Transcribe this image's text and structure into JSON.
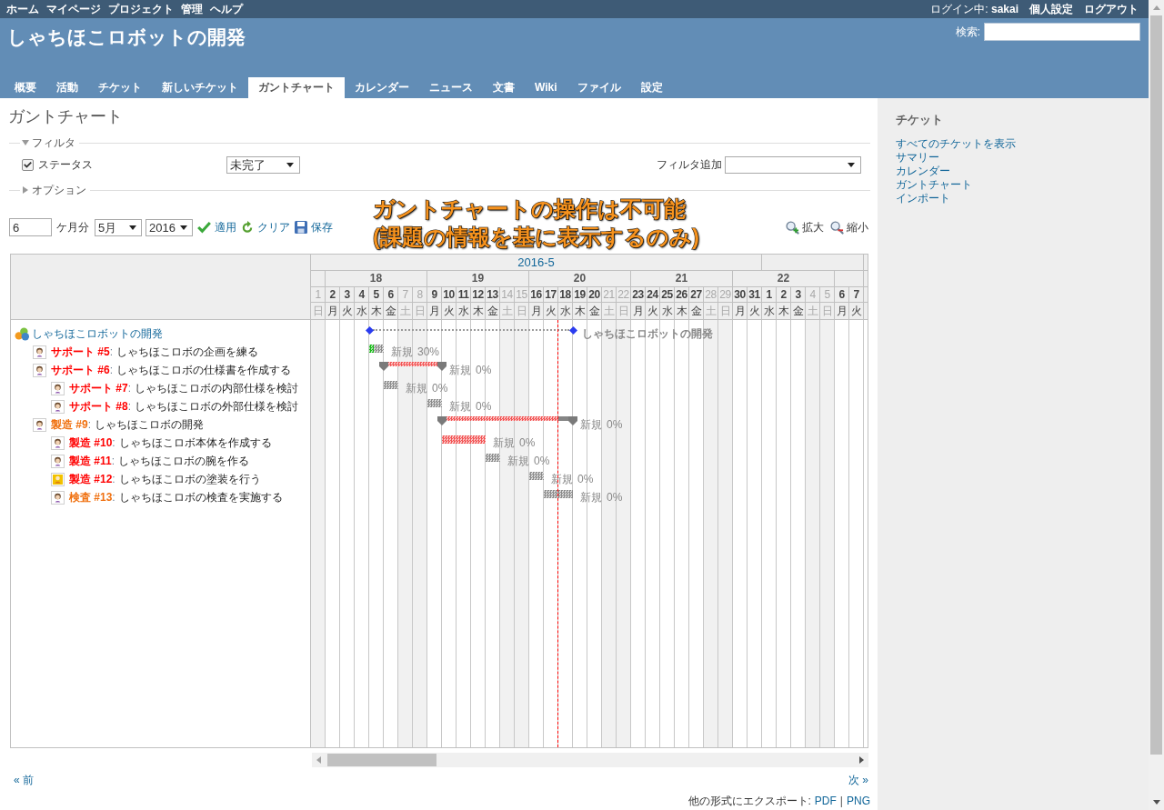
{
  "top_menu": {
    "items": [
      "ホーム",
      "マイページ",
      "プロジェクト",
      "管理",
      "ヘルプ"
    ],
    "login_label": "ログイン中:",
    "user": "sakai",
    "account_links": [
      "個人設定",
      "ログアウト"
    ]
  },
  "header": {
    "title": "しゃちほこロボットの開発",
    "search_label": "検索:"
  },
  "tabs": [
    {
      "label": "概要",
      "selected": false
    },
    {
      "label": "活動",
      "selected": false
    },
    {
      "label": "チケット",
      "selected": false
    },
    {
      "label": "新しいチケット",
      "selected": false
    },
    {
      "label": "ガントチャート",
      "selected": true
    },
    {
      "label": "カレンダー",
      "selected": false
    },
    {
      "label": "ニュース",
      "selected": false
    },
    {
      "label": "文書",
      "selected": false
    },
    {
      "label": "Wiki",
      "selected": false
    },
    {
      "label": "ファイル",
      "selected": false
    },
    {
      "label": "設定",
      "selected": false
    }
  ],
  "page_title": "ガントチャート",
  "filters": {
    "legend": "フィルタ",
    "expanded": true,
    "rows": [
      {
        "label": "ステータス",
        "checked": true,
        "value": "未完了"
      }
    ],
    "add_label": "フィルタ追加"
  },
  "options": {
    "legend": "オプション",
    "expanded": false
  },
  "controls": {
    "months": "6",
    "months_unit": "ケ月分",
    "month": "5月",
    "year": "2016",
    "actions": [
      {
        "kind": "apply",
        "label": "適用"
      },
      {
        "kind": "clear",
        "label": "クリア"
      },
      {
        "kind": "save",
        "label": "保存"
      }
    ],
    "zoom": [
      {
        "kind": "in",
        "label": "拡大"
      },
      {
        "kind": "out",
        "label": "縮小"
      }
    ]
  },
  "annotation": [
    "ガントチャートの操作は不可能",
    "(課題の情報を基に表示するのみ)"
  ],
  "gantt": {
    "months": [
      {
        "label": "2016-5",
        "weeks": [
          {
            "continued": false,
            "days": [
              {
                "label": "1",
                "weekday": "日",
                "weekend": true
              }
            ]
          },
          {
            "label": "18",
            "continued": false,
            "days": [
              {
                "label": "2",
                "weekday": "月",
                "weekend": false
              },
              {
                "label": "3",
                "weekday": "火",
                "weekend": false
              },
              {
                "label": "4",
                "weekday": "水",
                "weekend": false
              },
              {
                "label": "5",
                "weekday": "木",
                "weekend": false
              },
              {
                "label": "6",
                "weekday": "金",
                "weekend": false
              },
              {
                "label": "7",
                "weekday": "土",
                "weekend": true
              },
              {
                "label": "8",
                "weekday": "日",
                "weekend": true
              }
            ]
          },
          {
            "label": "19",
            "continued": false,
            "days": [
              {
                "label": "9",
                "weekday": "月",
                "weekend": false
              },
              {
                "label": "10",
                "weekday": "火",
                "weekend": false
              },
              {
                "label": "11",
                "weekday": "水",
                "weekend": false
              },
              {
                "label": "12",
                "weekday": "木",
                "weekend": false
              },
              {
                "label": "13",
                "weekday": "金",
                "weekend": false
              },
              {
                "label": "14",
                "weekday": "土",
                "weekend": true
              },
              {
                "label": "15",
                "weekday": "日",
                "weekend": true
              }
            ]
          },
          {
            "label": "20",
            "continued": false,
            "days": [
              {
                "label": "16",
                "weekday": "月",
                "weekend": false
              },
              {
                "label": "17",
                "weekday": "火",
                "weekend": false
              },
              {
                "label": "18",
                "weekday": "水",
                "weekend": false
              },
              {
                "label": "19",
                "weekday": "木",
                "weekend": false
              },
              {
                "label": "20",
                "weekday": "金",
                "weekend": false
              },
              {
                "label": "21",
                "weekday": "土",
                "weekend": true
              },
              {
                "label": "22",
                "weekday": "日",
                "weekend": true
              }
            ]
          },
          {
            "label": "21",
            "continued": false,
            "days": [
              {
                "label": "23",
                "weekday": "月",
                "weekend": false
              },
              {
                "label": "24",
                "weekday": "火",
                "weekend": false
              },
              {
                "label": "25",
                "weekday": "水",
                "weekend": false
              },
              {
                "label": "26",
                "weekday": "木",
                "weekend": false
              },
              {
                "label": "27",
                "weekday": "金",
                "weekend": false
              },
              {
                "label": "28",
                "weekday": "土",
                "weekend": true
              },
              {
                "label": "29",
                "weekday": "日",
                "weekend": true
              }
            ]
          },
          {
            "label": "22",
            "continued": false,
            "days": [
              {
                "label": "30",
                "weekday": "月",
                "weekend": false
              },
              {
                "label": "31",
                "weekday": "火",
                "weekend": false
              }
            ]
          }
        ]
      },
      {
        "weeks": [
          {
            "continued": true,
            "days": [
              {
                "label": "1",
                "weekday": "水",
                "weekend": false
              },
              {
                "label": "2",
                "weekday": "木",
                "weekend": false
              },
              {
                "label": "3",
                "weekday": "金",
                "weekend": false
              },
              {
                "label": "4",
                "weekday": "土",
                "weekend": true
              },
              {
                "label": "5",
                "weekday": "日",
                "weekend": true
              }
            ]
          },
          {
            "continued": false,
            "days": [
              {
                "label": "6",
                "weekday": "月",
                "weekend": false
              },
              {
                "label": "7",
                "weekday": "火",
                "weekend": false
              }
            ]
          }
        ]
      }
    ],
    "project": {
      "name": "しゃちほこロボットの開発",
      "bar_label": "しゃちほこロボットの開発",
      "children": [
        {
          "link": "サポート #5",
          "separator": ":",
          "subject": "しゃちほこロボの企画を練る",
          "color": "#ff0000",
          "avatar": {
            "kind": "person"
          },
          "kind": "task",
          "level": 0.3,
          "late": false,
          "status": "新規",
          "progress": "30%"
        },
        {
          "link": "サポート #6",
          "separator": ":",
          "subject": "しゃちほこロボの仕様書を作成する",
          "color": "#ff0000",
          "avatar": {
            "kind": "person"
          },
          "kind": "parent",
          "late": true,
          "status": "新規",
          "progress": "0%",
          "children": [
            {
              "link": "サポート #7",
              "separator": ":",
              "subject": "しゃちほこロボの内部仕様を検討",
              "color": "#ff0000",
              "avatar": {
                "kind": "person"
              },
              "kind": "task",
              "late": false,
              "status": "新規",
              "progress": "0%"
            },
            {
              "link": "サポート #8",
              "separator": ":",
              "subject": "しゃちほこロボの外部仕様を検討",
              "color": "#ff0000",
              "avatar": {
                "kind": "person"
              },
              "kind": "task",
              "late": false,
              "status": "新規",
              "progress": "0%"
            }
          ]
        },
        {
          "link": "製造 #9",
          "separator": ":",
          "subject": "しゃちほこロボの開発",
          "color": "#f0700f",
          "avatar": {
            "kind": "person"
          },
          "kind": "parent",
          "late": true,
          "status": "新規",
          "progress": "0%",
          "children": [
            {
              "link": "製造 #10",
              "separator": ":",
              "subject": "しゃちほこロボ本体を作成する",
              "color": "#ff0000",
              "avatar": {
                "kind": "person"
              },
              "kind": "task",
              "late": true,
              "status": "新規",
              "progress": "0%"
            },
            {
              "link": "製造 #11",
              "separator": ":",
              "subject": "しゃちほこロボの腕を作る",
              "color": "#ff0000",
              "avatar": {
                "kind": "person"
              },
              "kind": "task",
              "late": false,
              "status": "新規",
              "progress": "0%"
            },
            {
              "link": "製造 #12",
              "separator": ":",
              "subject": "しゃちほこロボの塗装を行う",
              "color": "#ff0000",
              "avatar": {
                "kind": "badge"
              },
              "kind": "task",
              "late": false,
              "status": "新規",
              "progress": "0%"
            },
            {
              "link": "検査 #13",
              "separator": ":",
              "subject": "しゃちほこロボの検査を実施する",
              "color": "#f0700f",
              "avatar": {
                "kind": "person"
              },
              "kind": "task",
              "late": false,
              "status": "新規",
              "progress": "0%"
            }
          ]
        }
      ]
    }
  },
  "pager": {
    "previous": "« 前",
    "next": "次 »"
  },
  "export": {
    "label": "他の形式にエクスポート:",
    "links": [
      "PDF",
      "PNG"
    ],
    "separator": "|"
  },
  "sidebar": {
    "title": "チケット",
    "links": [
      "すべてのチケットを表示",
      "サマリー",
      "カレンダー",
      "ガントチャート",
      "インポート"
    ]
  }
}
